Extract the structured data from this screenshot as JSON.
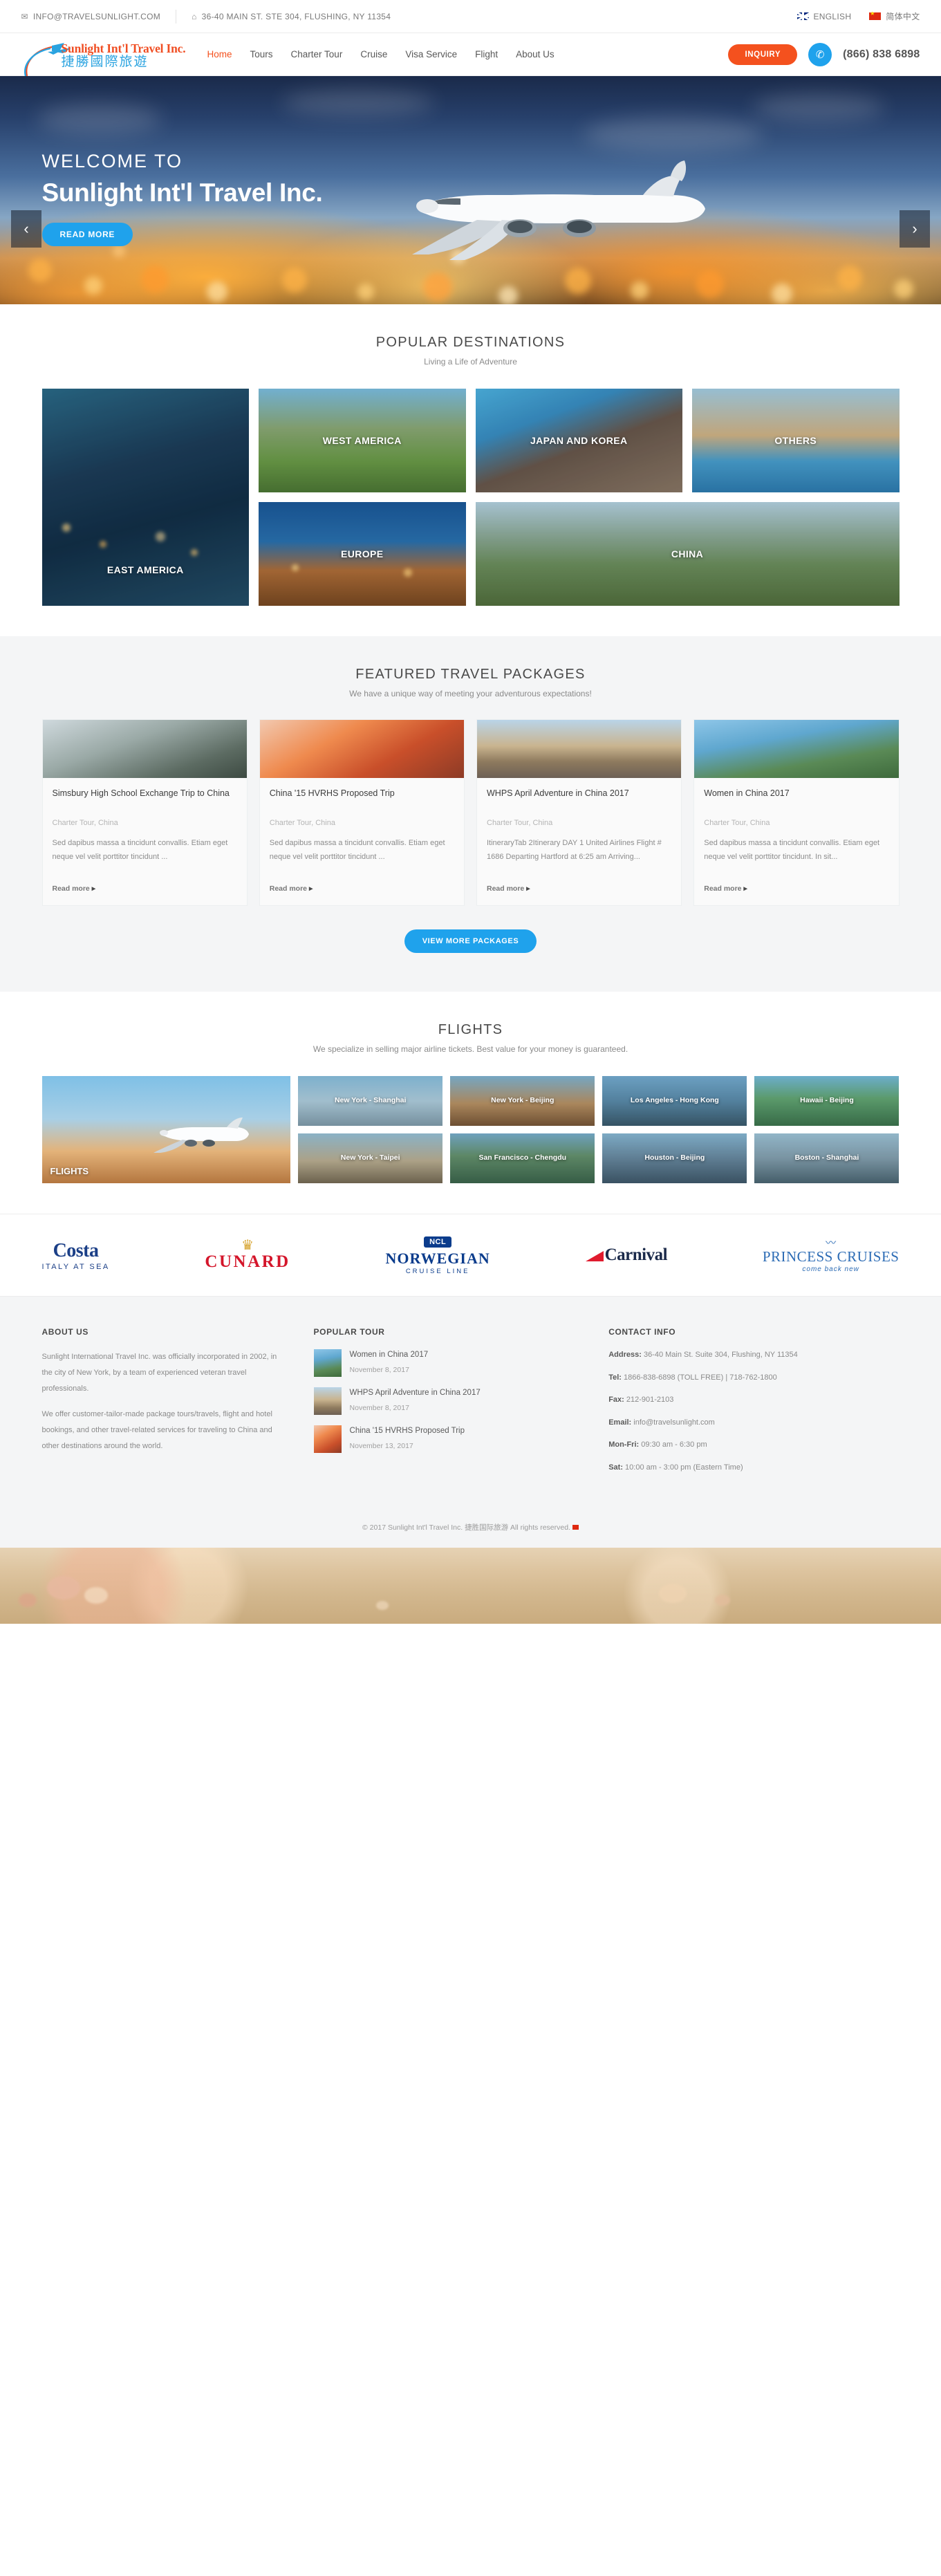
{
  "topbar": {
    "email": "INFO@TRAVELSUNLIGHT.COM",
    "address": "36-40 MAIN ST. STE 304, FLUSHING, NY 11354",
    "lang_en": "ENGLISH",
    "lang_cn": "简体中文"
  },
  "nav": {
    "logo_en": "Sunlight Int'l Travel Inc.",
    "logo_cn": "捷勝國際旅遊",
    "links": [
      {
        "label": "Home",
        "active": true
      },
      {
        "label": "Tours",
        "active": false
      },
      {
        "label": "Charter Tour",
        "active": false
      },
      {
        "label": "Cruise",
        "active": false
      },
      {
        "label": "Visa Service",
        "active": false
      },
      {
        "label": "Flight",
        "active": false
      },
      {
        "label": "About Us",
        "active": false
      }
    ],
    "inquiry_label": "INQUIRY",
    "phone": "(866) 838 6898"
  },
  "hero": {
    "welcome": "WELCOME TO",
    "title": "Sunlight Int'l Travel Inc.",
    "cta": "READ MORE",
    "prev": "‹",
    "next": "›"
  },
  "destinations": {
    "title": "POPULAR DESTINATIONS",
    "subtitle": "Living a Life of Adventure",
    "tiles": [
      {
        "label": "EAST AMERICA"
      },
      {
        "label": "WEST AMERICA"
      },
      {
        "label": "JAPAN AND KOREA"
      },
      {
        "label": "OTHERS"
      },
      {
        "label": "EUROPE"
      },
      {
        "label": "CHINA"
      }
    ]
  },
  "packages": {
    "title": "FEATURED TRAVEL PACKAGES",
    "subtitle": "We have a unique way of meeting your adventurous expectations!",
    "view_more": "VIEW MORE PACKAGES",
    "read_more": "Read more",
    "items": [
      {
        "title": "Simsbury High School Exchange Trip to China",
        "meta": "Charter Tour, China",
        "desc": "Sed dapibus massa a tincidunt convallis. Etiam eget neque vel velit porttitor tincidunt ..."
      },
      {
        "title": "China '15 HVRHS Proposed Trip",
        "meta": "Charter Tour, China",
        "desc": "Sed dapibus massa a tincidunt convallis. Etiam eget neque vel velit porttitor tincidunt ..."
      },
      {
        "title": "WHPS April Adventure in China 2017",
        "meta": "Charter Tour, China",
        "desc": "ItineraryTab 2Itinerary DAY 1 United Airlines Flight # 1686 Departing Hartford at 6:25 am Arriving..."
      },
      {
        "title": "Women in China 2017",
        "meta": "Charter Tour, China",
        "desc": "Sed dapibus massa a tincidunt convallis. Etiam eget neque vel velit porttitor tincidunt. In sit..."
      }
    ]
  },
  "flights": {
    "title": "FLIGHTS",
    "subtitle": "We specialize in selling major airline tickets. Best value for your money is guaranteed.",
    "main_label": "FLIGHTS",
    "cells": [
      {
        "label": "New York - Shanghai"
      },
      {
        "label": "New York - Beijing"
      },
      {
        "label": "Los Angeles - Hong Kong"
      },
      {
        "label": "Hawaii - Beijing"
      },
      {
        "label": "New York - Taipei"
      },
      {
        "label": "San Francisco - Chengdu"
      },
      {
        "label": "Houston - Beijing"
      },
      {
        "label": "Boston - Shanghai"
      }
    ]
  },
  "partners": [
    {
      "name": "Costa",
      "line1": "Costa",
      "line2": "ITALY AT SEA"
    },
    {
      "name": "Cunard",
      "line1": "CUNARD",
      "line2": ""
    },
    {
      "name": "Norwegian Cruise Line",
      "badge": "NCL",
      "line1": "NORWEGIAN",
      "line2": "CRUISE LINE"
    },
    {
      "name": "Carnival",
      "line1": "Carnival",
      "line2": ""
    },
    {
      "name": "Princess Cruises",
      "line1": "PRINCESS CRUISES",
      "line2": "come back new"
    }
  ],
  "footer": {
    "about_heading": "ABOUT US",
    "about_p1": "Sunlight International Travel Inc. was officially incorporated in 2002, in the city of New York, by a team of experienced veteran travel professionals.",
    "about_p2": "We offer customer-tailor-made package tours/travels, flight and hotel bookings, and other travel-related services for traveling to China and other destinations around the world.",
    "tour_heading": "POPULAR TOUR",
    "tours": [
      {
        "title": "Women in China 2017",
        "date": "November 8, 2017"
      },
      {
        "title": "WHPS April Adventure in China 2017",
        "date": "November 8, 2017"
      },
      {
        "title": "China '15 HVRHS Proposed Trip",
        "date": "November 13, 2017"
      }
    ],
    "contact_heading": "CONTACT INFO",
    "contact": [
      {
        "label": "Address:",
        "value": " 36-40 Main St. Suite 304, Flushing, NY 11354"
      },
      {
        "label": "Tel:",
        "value": " 1866-838-6898 (TOLL FREE) | 718-762-1800"
      },
      {
        "label": "Fax:",
        "value": " 212-901-2103"
      },
      {
        "label": "Email:",
        "value": " info@travelsunlight.com"
      },
      {
        "label": "Mon-Fri:",
        "value": " 09:30 am - 6:30 pm"
      },
      {
        "label": "Sat:",
        "value": " 10:00 am - 3:00 pm (Eastern Time)"
      }
    ],
    "copyright": "© 2017 Sunlight Int'l Travel Inc. 捷胜国际旅游 All rights reserved."
  }
}
